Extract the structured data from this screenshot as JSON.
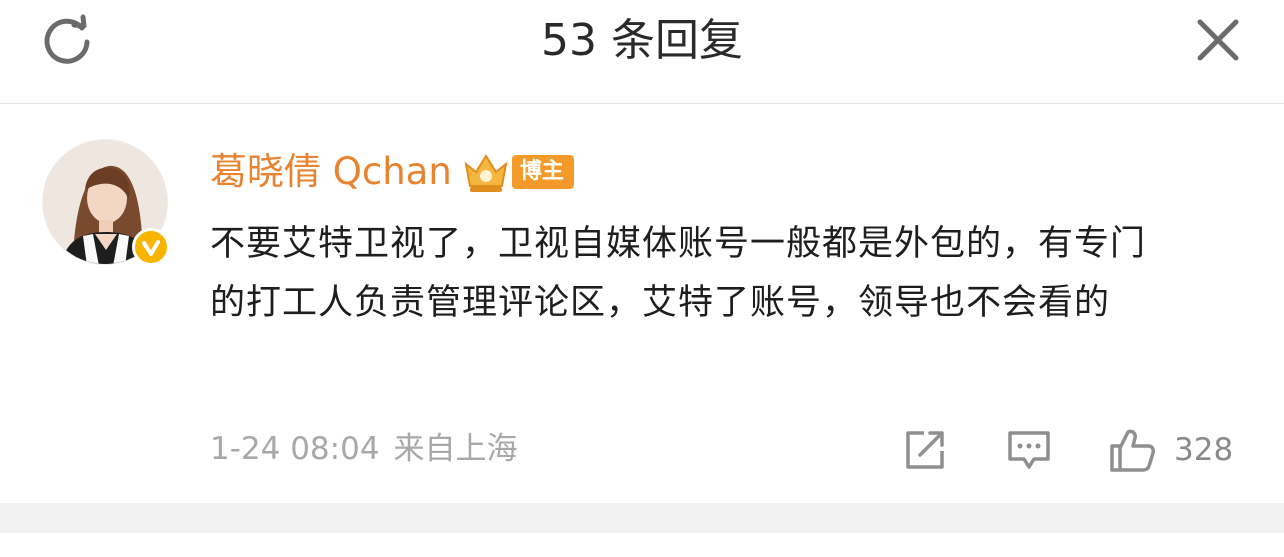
{
  "header": {
    "title": "53 条回复",
    "left_icon": "refresh-icon",
    "right_icon": "close-icon"
  },
  "comment": {
    "username": "葛晓倩 Qchan",
    "role_badge": "博主",
    "badge_icon": "crown-icon",
    "verified_icon": "verified-check-icon",
    "text": "不要艾特卫视了，卫视自媒体账号一般都是外包的，有专门的打工人负责管理评论区，艾特了账号，领导也不会看的",
    "timestamp": "1-24 08:04",
    "location": "来自上海",
    "actions": {
      "share_icon": "share-icon",
      "reply_icon": "comment-icon",
      "like_icon": "thumbs-up-icon",
      "like_count": "328"
    }
  },
  "colors": {
    "username": "#e8832f",
    "badge": "#f39a2a",
    "verified": "#f7b500",
    "meta": "#a8a8a8"
  }
}
